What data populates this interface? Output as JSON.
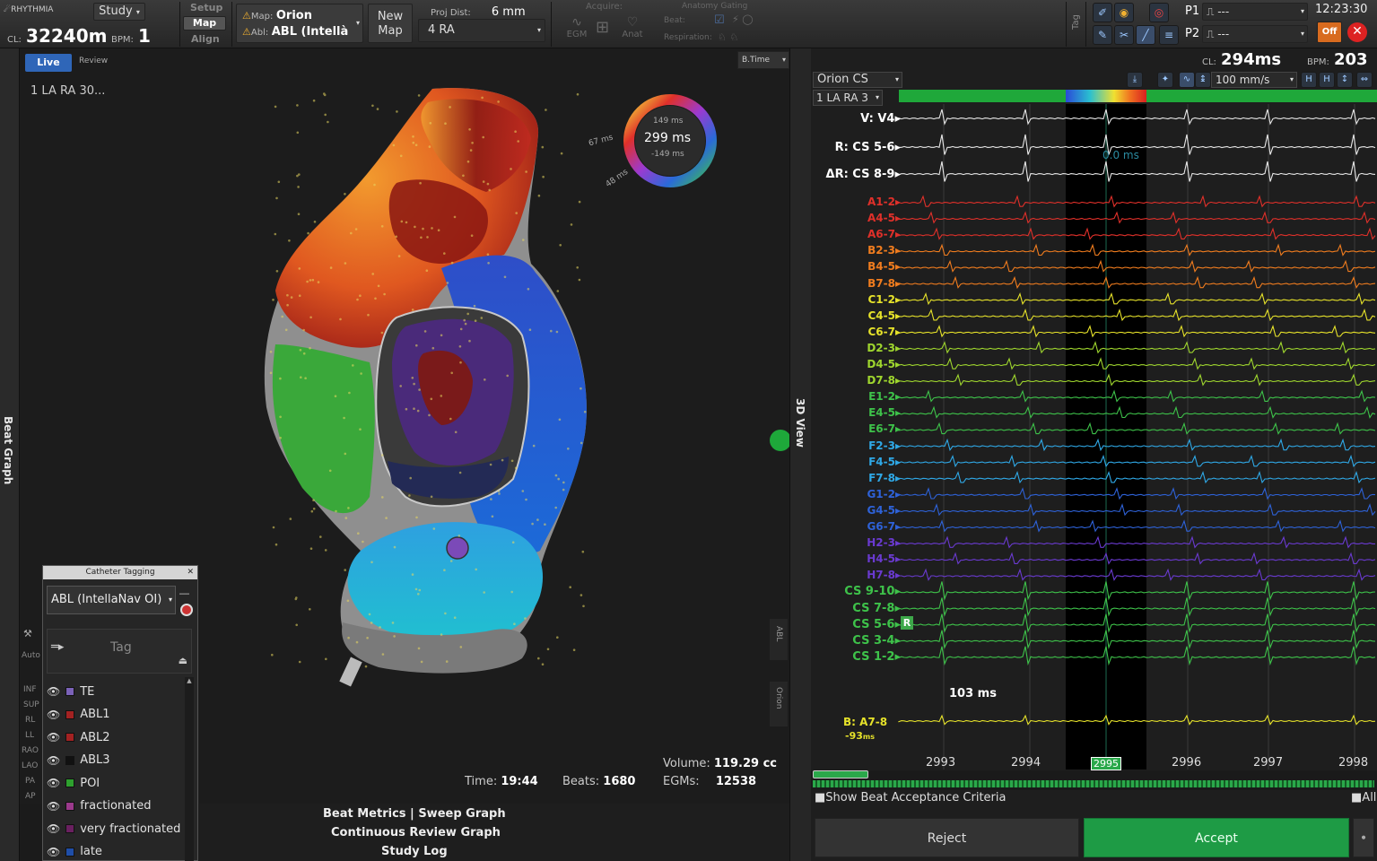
{
  "app": {
    "logo_text": "RHYTHMIA",
    "study_label": "Study"
  },
  "toolbar": {
    "cl_label": "CL:",
    "cl_value": "32240m",
    "bpm_label": "BPM:",
    "bpm_value": "1",
    "mode_tabs": [
      "Setup",
      "Map",
      "Align"
    ],
    "map_label": "Map:",
    "map_value": "Orion",
    "abl_label": "Abl:",
    "abl_value": "ABL (Intellà",
    "new_map_line1": "New",
    "new_map_line2": "Map",
    "proj_dist_label": "Proj Dist:",
    "proj_dist_value": "6 mm",
    "proj_select": "4 RA",
    "acquire_label": "Acquire:",
    "egm_label": "EGM",
    "anat_label": "Anat",
    "anatomy_gating_label": "Anatomy Gating",
    "beat_label": "Beat:",
    "respiration_label": "Respiration:",
    "tag_label": "Tag",
    "p1_label": "P1",
    "p1_value": "⎍ ---",
    "p2_label": "P2",
    "p2_value": "⎍ ---",
    "clock": "12:23:30",
    "off_label": "Off"
  },
  "view3d": {
    "live_tab": "Live",
    "review_tab": "Review",
    "btime_select": "B.Time",
    "map_name": "1 LA RA 30...",
    "ring_top": "149 ms",
    "ring_center": "299 ms",
    "ring_bottom": "-149 ms",
    "ring_left": "67 ms",
    "ring_lower": "48 ms",
    "side_label": "3D View",
    "abl_side": "ABL",
    "orion_side": "Orion",
    "time_label": "Time:",
    "time_value": "19:44",
    "beats_label": "Beats:",
    "beats_value": "1680",
    "volume_label": "Volume:",
    "volume_value": "119.29 cc",
    "egms_label": "EGMs:",
    "egms_value": "12538",
    "footer_links": [
      "Beat Metrics | Sweep Graph",
      "Continuous Review Graph",
      "Study Log"
    ]
  },
  "left_strip": {
    "beat_graph": "Beat Graph",
    "auto_label": "Auto",
    "views": [
      "INF",
      "SUP",
      "RL",
      "LL",
      "RAO",
      "LAO",
      "PA",
      "AP"
    ]
  },
  "catheter_tagging": {
    "title": "Catheter Tagging",
    "catheter_select": "ABL (IntellaNav OI)",
    "tag_label": "Tag",
    "tags": [
      {
        "label": "TE",
        "color": "#7b62b8"
      },
      {
        "label": "ABL1",
        "color": "#a32222"
      },
      {
        "label": "ABL2",
        "color": "#a32222"
      },
      {
        "label": "ABL3",
        "color": "#111111"
      },
      {
        "label": "POI",
        "color": "#2ea02e"
      },
      {
        "label": "fractionated",
        "color": "#9b3a8c"
      },
      {
        "label": "very fractionated",
        "color": "#6a2060"
      },
      {
        "label": "late",
        "color": "#1f4ea8"
      }
    ]
  },
  "egm_panel": {
    "cl_label": "CL:",
    "cl_value": "294ms",
    "bpm_label": "BPM:",
    "bpm_value": "203",
    "source_select": "Orion CS",
    "map_select": "1 LA RA 3",
    "sweep_select": "100 mm/s",
    "ref_channels": [
      {
        "label": "V: V4",
        "color": "#ffffff"
      },
      {
        "label": "R: CS 5-6",
        "color": "#ffffff"
      },
      {
        "label": "ΔR: CS 8-9",
        "color": "#ffffff"
      }
    ],
    "channels": [
      {
        "label": "A1-2",
        "color": "#e0302a"
      },
      {
        "label": "A4-5",
        "color": "#e0302a"
      },
      {
        "label": "A6-7",
        "color": "#e0302a"
      },
      {
        "label": "B2-3",
        "color": "#f07c1e"
      },
      {
        "label": "B4-5",
        "color": "#f07c1e"
      },
      {
        "label": "B7-8",
        "color": "#f07c1e"
      },
      {
        "label": "C1-2",
        "color": "#e6e22a"
      },
      {
        "label": "C4-5",
        "color": "#e6e22a"
      },
      {
        "label": "C6-7",
        "color": "#e6e22a"
      },
      {
        "label": "D2-3",
        "color": "#9fd62e"
      },
      {
        "label": "D4-5",
        "color": "#9fd62e"
      },
      {
        "label": "D7-8",
        "color": "#9fd62e"
      },
      {
        "label": "E1-2",
        "color": "#3ec24a"
      },
      {
        "label": "E4-5",
        "color": "#3ec24a"
      },
      {
        "label": "E6-7",
        "color": "#3ec24a"
      },
      {
        "label": "F2-3",
        "color": "#2fa8e6"
      },
      {
        "label": "F4-5",
        "color": "#2fa8e6"
      },
      {
        "label": "F7-8",
        "color": "#2fa8e6"
      },
      {
        "label": "G1-2",
        "color": "#2e62d8"
      },
      {
        "label": "G4-5",
        "color": "#2e62d8"
      },
      {
        "label": "G6-7",
        "color": "#2e62d8"
      },
      {
        "label": "H2-3",
        "color": "#6a3ad0"
      },
      {
        "label": "H4-5",
        "color": "#6a3ad0"
      },
      {
        "label": "H7-8",
        "color": "#6a3ad0"
      },
      {
        "label": "CS 9-10",
        "color": "#3ec24a"
      },
      {
        "label": "CS 7-8",
        "color": "#3ec24a"
      },
      {
        "label": "CS 5-6",
        "color": "#3ec24a"
      },
      {
        "label": "CS 3-4",
        "color": "#3ec24a"
      },
      {
        "label": "CS 1-2",
        "color": "#3ec24a"
      }
    ],
    "ref_marker": "R",
    "interval_value": "103 ms",
    "cursor_value": "0.0 ms",
    "b_channel_label": "B: A7-8",
    "b_channel_value": "-93",
    "b_channel_unit": "ms",
    "beat_ticks": [
      "2993",
      "2994",
      "2995",
      "2996",
      "2997",
      "2998"
    ],
    "show_criteria": "Show Beat Acceptance Criteria",
    "all_label": "All",
    "reject_label": "Reject",
    "accept_label": "Accept"
  }
}
